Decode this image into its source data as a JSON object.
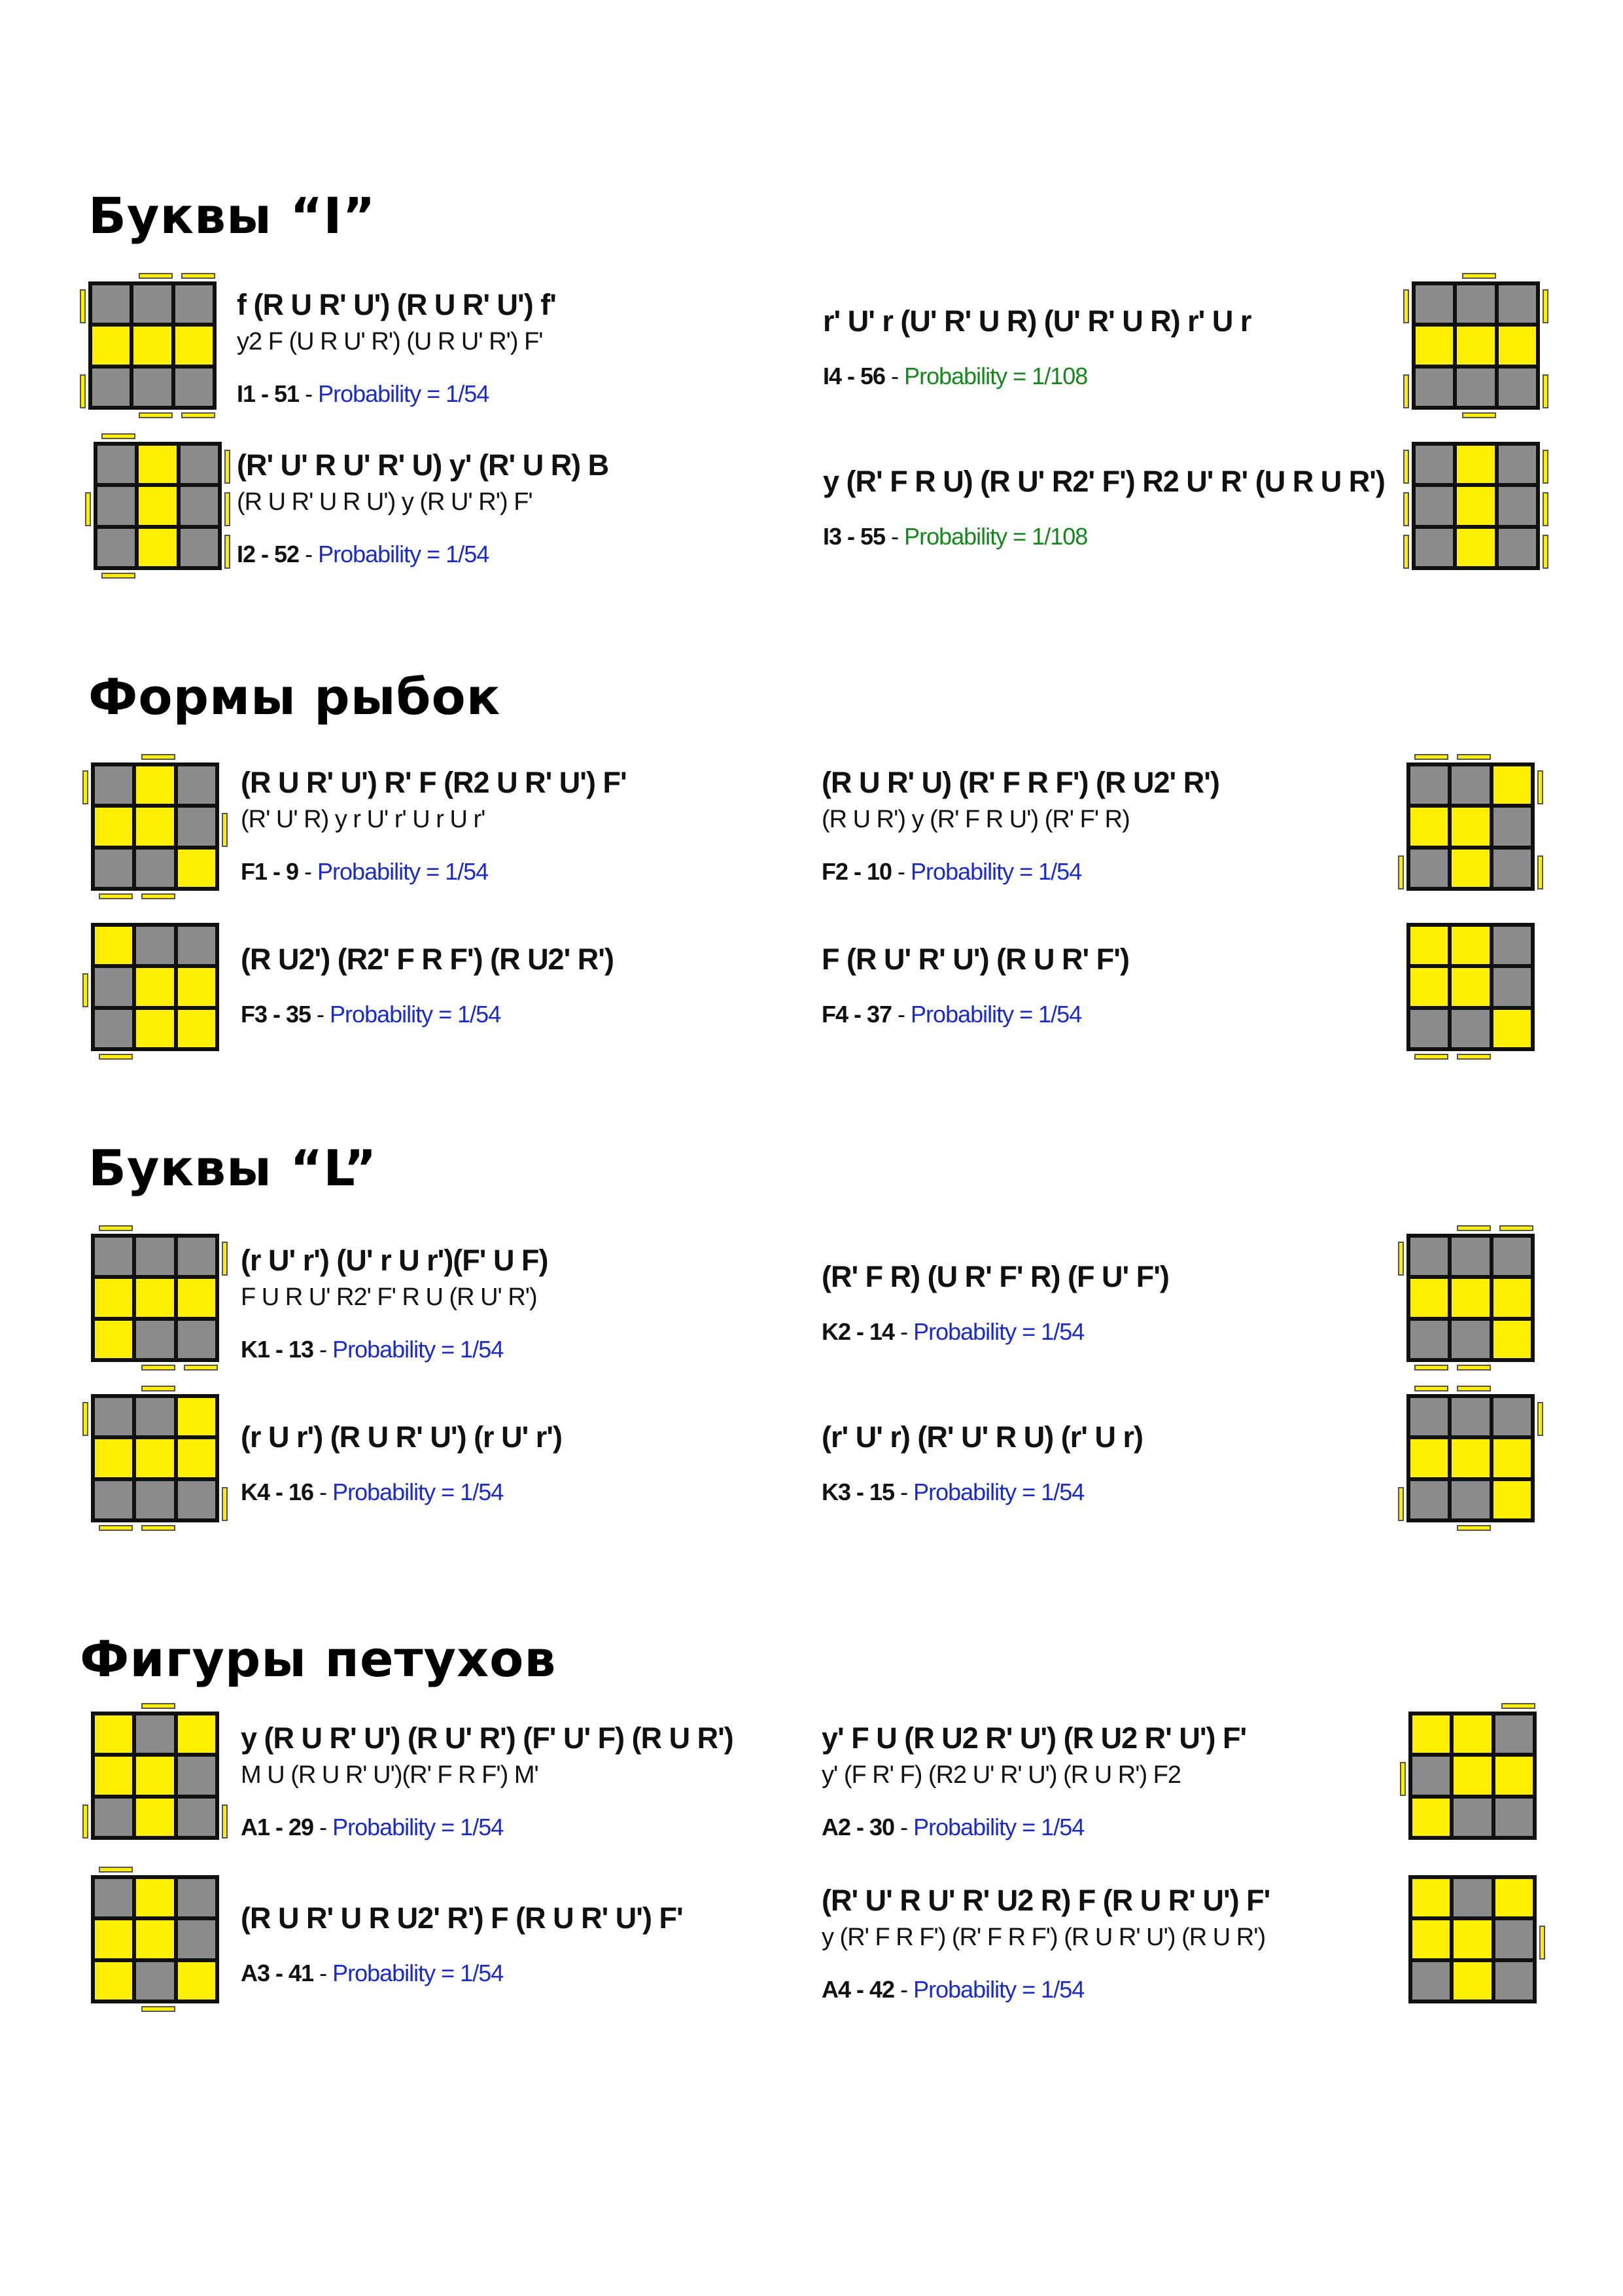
{
  "sections": [
    {
      "title": "Буквы “I”",
      "cases": [
        {
          "main": "f (R U R' U') (R U R' U') f'",
          "alt": "y2 F (U R U' R') (U R U' R') F'",
          "id": "I1 - 51",
          "sep": " - ",
          "prob": "Probability = 1/54",
          "pattern": [
            0,
            0,
            0,
            1,
            1,
            1,
            0,
            0,
            0
          ],
          "sides": {
            "top": [
              0,
              1,
              1
            ],
            "bottom": [
              0,
              1,
              1
            ],
            "left": [
              1,
              0,
              1
            ],
            "right": [
              0,
              0,
              0
            ]
          }
        },
        {
          "main": "r' U' r (U' R' U R) (U' R' U R) r' U r",
          "alt": "",
          "id": "I4 - 56",
          "sep": " - ",
          "prob": "Probability = 1/108",
          "prob_color": "green",
          "pattern": [
            0,
            0,
            0,
            1,
            1,
            1,
            0,
            0,
            0
          ],
          "sides": {
            "top": [
              0,
              1,
              0
            ],
            "bottom": [
              0,
              1,
              0
            ],
            "left": [
              1,
              0,
              1
            ],
            "right": [
              1,
              0,
              1
            ]
          }
        },
        {
          "main": "(R' U' R U' R' U) y' (R' U R) B",
          "alt": "(R U R' U R U') y (R U' R') F'",
          "id": "I2 - 52",
          "sep": " - ",
          "prob": "Probability = 1/54",
          "pattern": [
            0,
            1,
            0,
            0,
            1,
            0,
            0,
            1,
            0
          ],
          "sides": {
            "top": [
              1,
              0,
              0
            ],
            "bottom": [
              1,
              0,
              0
            ],
            "left": [
              0,
              1,
              0
            ],
            "right": [
              1,
              1,
              1
            ]
          }
        },
        {
          "main": "y (R' F R U) (R U' R2' F') R2 U' R' (U R U R')",
          "alt": "",
          "id": "I3 - 55",
          "sep": " - ",
          "prob": "Probability = 1/108",
          "prob_color": "green",
          "pattern": [
            0,
            1,
            0,
            0,
            1,
            0,
            0,
            1,
            0
          ],
          "sides": {
            "top": [
              0,
              0,
              0
            ],
            "bottom": [
              0,
              0,
              0
            ],
            "left": [
              1,
              1,
              1
            ],
            "right": [
              1,
              1,
              1
            ]
          }
        }
      ]
    },
    {
      "title": "Формы рыбок",
      "cases": [
        {
          "main": "(R U R' U') R' F (R2 U R' U') F'",
          "alt": "(R' U' R) y r U' r' U r U r'",
          "id": "F1 - 9",
          "sep": " - ",
          "prob": "Probability = 1/54",
          "pattern": [
            0,
            1,
            0,
            1,
            1,
            0,
            0,
            0,
            1
          ],
          "sides": {
            "top": [
              0,
              1,
              0
            ],
            "bottom": [
              1,
              1,
              0
            ],
            "left": [
              1,
              0,
              0
            ],
            "right": [
              0,
              1,
              0
            ]
          }
        },
        {
          "main": "(R U R' U) (R' F R F') (R U2' R')",
          "alt": "(R U R') y (R' F R U') (R' F' R)",
          "id": "F2 - 10",
          "sep": " - ",
          "prob": "Probability = 1/54",
          "pattern": [
            0,
            0,
            1,
            1,
            1,
            0,
            0,
            1,
            0
          ],
          "sides": {
            "top": [
              1,
              1,
              0
            ],
            "bottom": [
              0,
              0,
              0
            ],
            "left": [
              0,
              0,
              1
            ],
            "right": [
              1,
              0,
              1
            ]
          }
        },
        {
          "main": "(R U2') (R2' F R F') (R U2' R')",
          "alt": "",
          "id": "F3 - 35",
          "sep": " - ",
          "prob": "Probability = 1/54",
          "pattern": [
            1,
            0,
            0,
            0,
            1,
            1,
            0,
            1,
            1
          ],
          "sides": {
            "top": [
              0,
              0,
              0
            ],
            "bottom": [
              1,
              0,
              0
            ],
            "left": [
              0,
              1,
              0
            ],
            "right": [
              0,
              0,
              0
            ]
          }
        },
        {
          "main": "F (R U' R' U') (R U R' F')",
          "alt": "",
          "id": "F4 - 37",
          "sep": " - ",
          "prob": "Probability = 1/54",
          "pattern": [
            1,
            1,
            0,
            1,
            1,
            0,
            0,
            0,
            1
          ],
          "sides": {
            "top": [
              0,
              0,
              0
            ],
            "bottom": [
              1,
              1,
              0
            ],
            "left": [
              0,
              0,
              0
            ],
            "right": [
              0,
              0,
              0
            ]
          }
        }
      ]
    },
    {
      "title": "Буквы “L”",
      "cases": [
        {
          "main": "(r U' r') (U' r U r')(F' U F)",
          "alt": "F U R U' R2' F' R U (R U' R')",
          "id": "K1 - 13",
          "sep": " - ",
          "prob": "Probability = 1/54",
          "pattern": [
            0,
            0,
            0,
            1,
            1,
            1,
            1,
            0,
            0
          ],
          "sides": {
            "top": [
              1,
              0,
              0
            ],
            "bottom": [
              0,
              1,
              1
            ],
            "left": [
              0,
              0,
              0
            ],
            "right": [
              1,
              0,
              0
            ]
          }
        },
        {
          "main": "(R' F R) (U R' F' R) (F U' F')",
          "alt": "",
          "id": "K2 - 14",
          "sep": " - ",
          "prob": "Probability = 1/54",
          "pattern": [
            0,
            0,
            0,
            1,
            1,
            1,
            0,
            0,
            1
          ],
          "sides": {
            "top": [
              0,
              1,
              1
            ],
            "bottom": [
              1,
              1,
              0
            ],
            "left": [
              1,
              0,
              0
            ],
            "right": [
              0,
              0,
              0
            ]
          }
        },
        {
          "main": "(r U r') (R U R' U') (r U' r')",
          "alt": "",
          "id": "K4 - 16",
          "sep": " - ",
          "prob": "Probability = 1/54",
          "pattern": [
            0,
            0,
            1,
            1,
            1,
            1,
            0,
            0,
            0
          ],
          "sides": {
            "top": [
              0,
              1,
              0
            ],
            "bottom": [
              1,
              1,
              0
            ],
            "left": [
              1,
              0,
              0
            ],
            "right": [
              0,
              0,
              1
            ]
          }
        },
        {
          "main": "(r' U' r) (R' U' R U) (r' U r)",
          "alt": "",
          "id": "K3 - 15",
          "sep": " - ",
          "prob": "Probability = 1/54",
          "pattern": [
            0,
            0,
            0,
            1,
            1,
            1,
            0,
            0,
            1
          ],
          "sides": {
            "top": [
              1,
              1,
              0
            ],
            "bottom": [
              0,
              1,
              0
            ],
            "left": [
              0,
              0,
              1
            ],
            "right": [
              1,
              0,
              0
            ]
          }
        }
      ]
    },
    {
      "title": "Фигуры петухов",
      "cases": [
        {
          "main": "y (R U R' U') (R U' R') (F' U' F) (R U R')",
          "alt": "M U (R U R' U')(R' F R F') M'",
          "id": "A1 - 29",
          "sep": " - ",
          "prob": "Probability = 1/54",
          "pattern": [
            1,
            0,
            1,
            1,
            1,
            0,
            0,
            1,
            0
          ],
          "sides": {
            "top": [
              0,
              1,
              0
            ],
            "bottom": [
              0,
              0,
              0
            ],
            "left": [
              0,
              0,
              1
            ],
            "right": [
              0,
              0,
              1
            ]
          }
        },
        {
          "main": "y' F U (R U2 R' U') (R U2 R' U') F'",
          "alt": "y' (F R' F) (R2 U' R' U') (R U R') F2",
          "id": "A2 - 30",
          "sep": " - ",
          "prob": "Probability = 1/54",
          "pattern": [
            1,
            1,
            0,
            0,
            1,
            1,
            1,
            0,
            0
          ],
          "sides": {
            "top": [
              0,
              0,
              1
            ],
            "bottom": [
              0,
              0,
              0
            ],
            "left": [
              0,
              1,
              0
            ],
            "right": [
              0,
              0,
              0
            ]
          }
        },
        {
          "main": "(R U R' U R U2' R') F (R U R' U') F'",
          "alt": "",
          "id": "A3 - 41",
          "sep": " - ",
          "prob": "Probability = 1/54",
          "pattern": [
            0,
            1,
            0,
            1,
            1,
            0,
            1,
            0,
            1
          ],
          "sides": {
            "top": [
              1,
              0,
              0
            ],
            "bottom": [
              0,
              1,
              0
            ],
            "left": [
              0,
              0,
              0
            ],
            "right": [
              0,
              0,
              0
            ]
          }
        },
        {
          "main": "(R' U' R U' R' U2 R) F (R U R' U') F'",
          "alt": "y (R' F R F') (R' F R F') (R U R' U') (R U R')",
          "id": "A4 - 42",
          "sep": " - ",
          "prob": "Probability = 1/54",
          "pattern": [
            1,
            0,
            1,
            1,
            1,
            0,
            0,
            1,
            0
          ],
          "sides": {
            "top": [
              0,
              0,
              0
            ],
            "bottom": [
              0,
              0,
              0
            ],
            "left": [
              0,
              0,
              0
            ],
            "right": [
              0,
              1,
              0
            ]
          }
        }
      ]
    }
  ]
}
